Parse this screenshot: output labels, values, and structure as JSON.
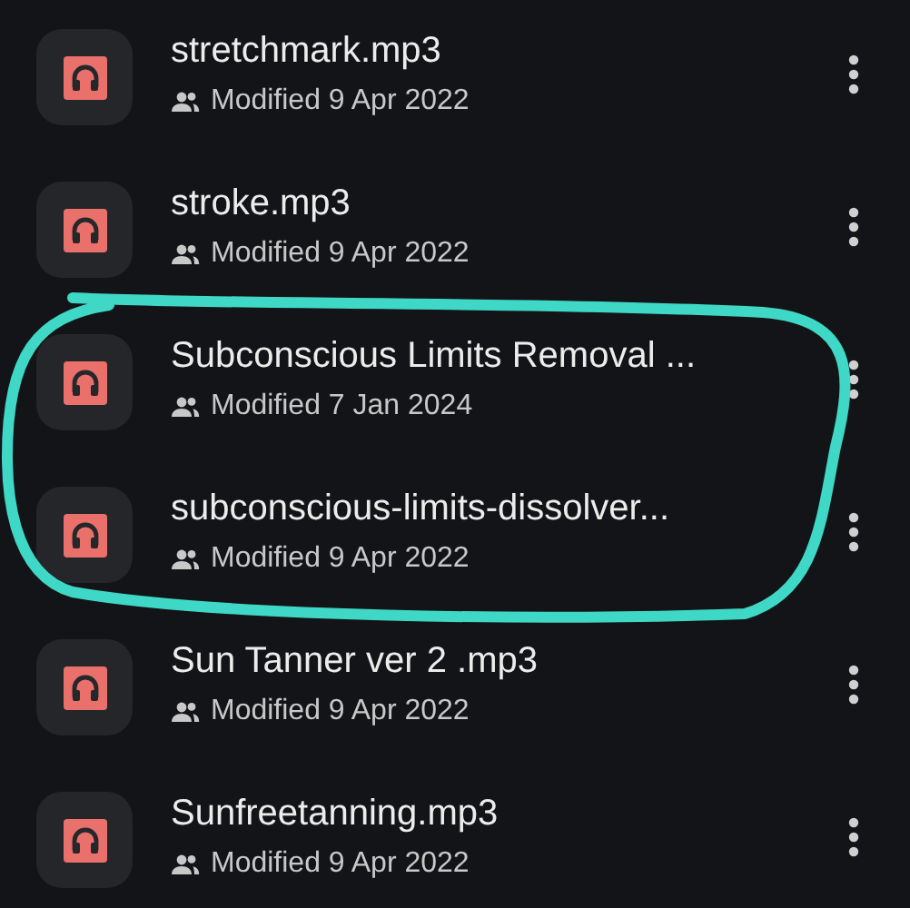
{
  "files": [
    {
      "name": "stretchmark.mp3",
      "modified": "Modified 9 Apr 2022",
      "circled": false
    },
    {
      "name": "stroke.mp3",
      "modified": "Modified 9 Apr 2022",
      "circled": false
    },
    {
      "name": "Subconscious Limits Removal ...",
      "modified": "Modified 7 Jan 2024",
      "circled": true
    },
    {
      "name": "subconscious-limits-dissolver...",
      "modified": "Modified 9 Apr 2022",
      "circled": true
    },
    {
      "name": "Sun Tanner ver 2 .mp3",
      "modified": "Modified 9 Apr 2022",
      "circled": false
    },
    {
      "name": "Sunfreetanning.mp3",
      "modified": "Modified 9 Apr 2022",
      "circled": false
    }
  ]
}
